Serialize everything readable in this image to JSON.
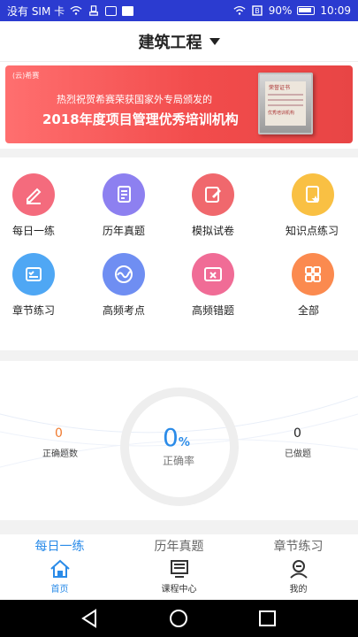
{
  "status_bar": {
    "carrier": "没有 SIM 卡",
    "battery": "90%",
    "time": "10:09"
  },
  "header": {
    "title": "建筑工程"
  },
  "banner": {
    "logo": "(云)希赛",
    "line1": "热烈祝贺希赛荣获国家外专局颁发的",
    "line2": "2018年度项目管理优秀培训机构",
    "cert_title": "荣誉证书",
    "cert_stamp": "优秀培训机构"
  },
  "grid": [
    {
      "label": "每日一练",
      "color": "#f46b7d"
    },
    {
      "label": "历年真题",
      "color": "#8d80f0"
    },
    {
      "label": "模拟试卷",
      "color": "#f0686d"
    },
    {
      "label": "知识点练习",
      "color": "#f9c043"
    },
    {
      "label": "章节练习",
      "color": "#4fa7f4"
    },
    {
      "label": "高频考点",
      "color": "#6f8ef2"
    },
    {
      "label": "高频错题",
      "color": "#f06c96"
    },
    {
      "label": "全部",
      "color": "#fb8a4f"
    }
  ],
  "stats": {
    "correct_count": "0",
    "correct_count_label": "正确题数",
    "rate_value": "0",
    "rate_unit": "%",
    "rate_label": "正确率",
    "done_count": "0",
    "done_count_label": "已做题"
  },
  "sub_tabs": [
    "每日一练",
    "历年真题",
    "章节练习"
  ],
  "nav": {
    "home": "首页",
    "courses": "课程中心",
    "mine": "我的"
  },
  "accent_color": "#2a8be8"
}
